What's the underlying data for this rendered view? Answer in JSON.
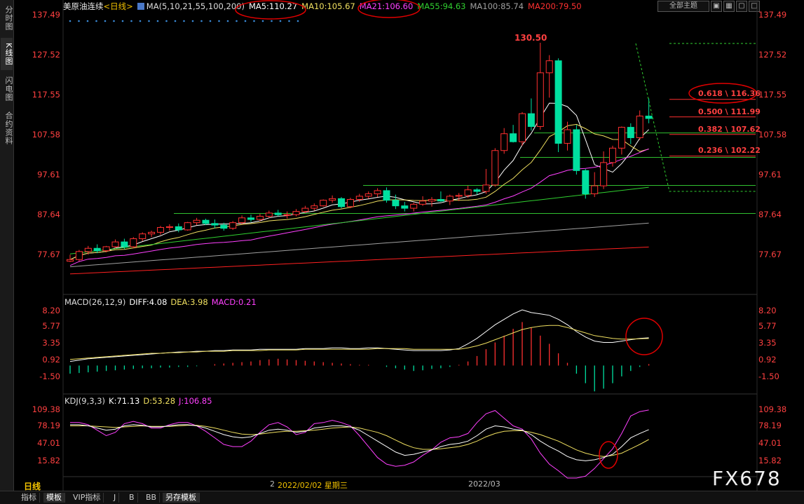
{
  "sidebar": {
    "tabs": [
      {
        "label": "分时图",
        "active": false
      },
      {
        "label": "K线图",
        "active": true
      },
      {
        "label": "闪电图",
        "active": false
      },
      {
        "label": "合约资料",
        "active": false
      }
    ]
  },
  "header": {
    "instrument": "美原油连续",
    "period": "<日线>",
    "ma_params": "MA(5,10,21,55,100,200)",
    "ma5": "MA5:110.27",
    "ma10": "MA10:105.67",
    "ma21": "MA21:106.60",
    "ma55": "MA55:94.63",
    "ma100": "MA100:85.74",
    "ma200": "MA200:79.50",
    "theme_select": "全部主题"
  },
  "colors": {
    "up": "#ff3030",
    "down": "#00e0a0",
    "ma5": "#ffffff",
    "ma10": "#f0e060",
    "ma21": "#ff40ff",
    "ma55": "#30d030",
    "ma100": "#a0a0a0",
    "ma200": "#ff2020",
    "axis": "#ff3c3c",
    "annotation": "#ff0000"
  },
  "price_axis": {
    "labels": [
      "137.49",
      "127.52",
      "117.55",
      "107.58",
      "97.61",
      "87.64",
      "77.67"
    ]
  },
  "fibonacci": [
    {
      "label": "0.618 \\ 116.36",
      "value": 116.36
    },
    {
      "label": "0.500 \\ 111.99",
      "value": 111.99
    },
    {
      "label": "0.382 \\ 107.62",
      "value": 107.62
    },
    {
      "label": "0.236 \\ 102.22",
      "value": 102.22
    }
  ],
  "high_label": "130.50",
  "macd": {
    "title": "MACD(26,12,9)",
    "diff": "DIFF:4.08",
    "dea": "DEA:3.98",
    "macd": "MACD:0.21",
    "axis_labels": [
      "8.20",
      "5.77",
      "3.35",
      "0.92",
      "-1.50"
    ]
  },
  "kdj": {
    "title": "KDJ(9,3,3)",
    "k": "K:71.13",
    "d": "D:53.28",
    "j": "J:106.85",
    "axis_labels": [
      "109.38",
      "78.19",
      "47.01",
      "15.82"
    ]
  },
  "x_axis": {
    "label_a": "2",
    "label_b": "2022/02/02 星期三",
    "label_c": "2022/03"
  },
  "period_label": "日线",
  "bottom_tabs": [
    {
      "label": "指标",
      "active": false
    },
    {
      "label": "模板",
      "active": true
    },
    {
      "label": "VIP指标",
      "active": false
    },
    {
      "label": "J",
      "active": false
    },
    {
      "label": "B",
      "active": false
    },
    {
      "label": "BB",
      "active": false
    },
    {
      "label": "另存模板",
      "active": true
    }
  ],
  "watermark": "FX678",
  "chart_data": {
    "type": "candlestick",
    "ylim": [
      72,
      140
    ],
    "candles": [
      [
        76.0,
        77.6,
        75.8,
        76.4
      ],
      [
        76.4,
        78.8,
        76.0,
        78.4
      ],
      [
        78.4,
        79.8,
        77.6,
        79.2
      ],
      [
        79.2,
        80.2,
        78.0,
        78.6
      ],
      [
        78.6,
        79.8,
        78.2,
        79.6
      ],
      [
        79.6,
        81.4,
        79.2,
        80.8
      ],
      [
        80.8,
        81.6,
        79.0,
        79.6
      ],
      [
        79.6,
        82.0,
        79.2,
        81.6
      ],
      [
        81.6,
        83.2,
        81.0,
        82.8
      ],
      [
        82.8,
        83.6,
        82.0,
        83.2
      ],
      [
        83.2,
        84.8,
        82.6,
        84.4
      ],
      [
        84.4,
        85.2,
        83.6,
        84.6
      ],
      [
        84.6,
        85.4,
        83.2,
        83.8
      ],
      [
        83.8,
        85.8,
        83.6,
        85.6
      ],
      [
        85.6,
        86.8,
        85.0,
        86.2
      ],
      [
        86.2,
        86.6,
        85.0,
        85.4
      ],
      [
        85.4,
        86.4,
        84.2,
        85.0
      ],
      [
        85.0,
        85.6,
        83.6,
        84.2
      ],
      [
        84.2,
        86.0,
        83.8,
        85.6
      ],
      [
        85.6,
        87.4,
        85.2,
        86.8
      ],
      [
        86.8,
        87.6,
        85.8,
        86.4
      ],
      [
        86.4,
        87.8,
        86.0,
        87.2
      ],
      [
        87.2,
        88.6,
        86.8,
        88.0
      ],
      [
        88.0,
        88.8,
        87.2,
        87.6
      ],
      [
        87.6,
        88.4,
        86.6,
        87.6
      ],
      [
        87.6,
        89.0,
        87.2,
        88.4
      ],
      [
        88.4,
        89.8,
        88.0,
        89.2
      ],
      [
        89.2,
        90.4,
        88.6,
        89.8
      ],
      [
        89.8,
        91.4,
        89.6,
        91.2
      ],
      [
        91.2,
        92.4,
        90.6,
        91.6
      ],
      [
        91.6,
        92.0,
        89.2,
        89.6
      ],
      [
        89.6,
        91.8,
        89.2,
        91.4
      ],
      [
        91.4,
        92.8,
        90.8,
        92.2
      ],
      [
        92.2,
        93.4,
        91.6,
        92.8
      ],
      [
        92.8,
        94.2,
        92.0,
        93.6
      ],
      [
        93.6,
        94.4,
        90.6,
        91.2
      ],
      [
        91.2,
        92.6,
        89.0,
        89.8
      ],
      [
        89.8,
        90.8,
        88.4,
        89.2
      ],
      [
        89.2,
        90.6,
        88.4,
        90.2
      ],
      [
        90.2,
        92.2,
        89.8,
        91.0
      ],
      [
        91.0,
        92.0,
        89.6,
        91.4
      ],
      [
        91.4,
        93.4,
        90.8,
        91.0
      ],
      [
        91.0,
        92.6,
        90.0,
        92.2
      ],
      [
        92.2,
        93.0,
        91.0,
        92.4
      ],
      [
        92.4,
        94.8,
        91.8,
        93.8
      ],
      [
        93.8,
        94.2,
        92.6,
        93.4
      ],
      [
        93.4,
        99.0,
        92.8,
        95.0
      ],
      [
        95.0,
        104.2,
        94.6,
        103.6
      ],
      [
        103.6,
        109.2,
        102.8,
        107.8
      ],
      [
        107.8,
        110.0,
        105.6,
        105.8
      ],
      [
        105.8,
        113.2,
        104.8,
        112.8
      ],
      [
        112.8,
        116.6,
        108.6,
        109.6
      ],
      [
        109.6,
        130.5,
        108.8,
        123.0
      ],
      [
        123.0,
        127.4,
        116.8,
        126.0
      ],
      [
        126.0,
        126.6,
        103.2,
        105.4
      ],
      [
        105.4,
        110.8,
        103.6,
        108.8
      ],
      [
        108.8,
        110.0,
        97.6,
        98.6
      ],
      [
        98.6,
        99.0,
        91.6,
        92.8
      ],
      [
        92.8,
        98.2,
        92.0,
        94.8
      ],
      [
        94.8,
        103.4,
        94.0,
        100.6
      ],
      [
        100.6,
        104.8,
        99.6,
        104.2
      ],
      [
        104.2,
        109.6,
        102.6,
        109.4
      ],
      [
        109.4,
        110.4,
        105.2,
        106.8
      ],
      [
        106.8,
        113.6,
        106.2,
        112.2
      ],
      [
        112.2,
        116.6,
        110.4,
        111.6
      ]
    ],
    "macd_values": [
      -1.2,
      -1.1,
      -1.0,
      -0.9,
      -0.8,
      -0.7,
      -0.6,
      -0.5,
      -0.4,
      -0.4,
      -0.3,
      -0.3,
      -0.2,
      -0.2,
      -0.1,
      0,
      0.2,
      0.3,
      0.4,
      0.5,
      0.6,
      0.8,
      0.9,
      1.0,
      0.9,
      0.8,
      0.7,
      0.6,
      0.5,
      0.4,
      0.3,
      0.2,
      0.1,
      0.1,
      0,
      -0.2,
      -0.4,
      -0.6,
      -0.8,
      -0.7,
      -0.5,
      -0.4,
      -0.2,
      0.1,
      0.6,
      1.4,
      2.4,
      3.4,
      4.4,
      5.4,
      6.4,
      5.6,
      4.4,
      3.2,
      1.8,
      0.4,
      -1.2,
      -2.6,
      -3.8,
      -3.4,
      -2.6,
      -1.6,
      -0.8,
      -0.2,
      0.21
    ],
    "diff": [
      0.6,
      0.8,
      1.0,
      1.1,
      1.2,
      1.3,
      1.4,
      1.5,
      1.6,
      1.7,
      1.8,
      1.9,
      2.0,
      2.0,
      2.1,
      2.1,
      2.2,
      2.2,
      2.3,
      2.3,
      2.3,
      2.4,
      2.4,
      2.4,
      2.4,
      2.4,
      2.5,
      2.5,
      2.5,
      2.6,
      2.6,
      2.5,
      2.5,
      2.6,
      2.6,
      2.5,
      2.4,
      2.3,
      2.2,
      2.2,
      2.2,
      2.2,
      2.3,
      2.5,
      3.2,
      4.0,
      5.0,
      6.0,
      6.8,
      7.6,
      8.2,
      7.8,
      7.6,
      7.4,
      6.8,
      6.0,
      5.0,
      4.2,
      3.6,
      3.4,
      3.4,
      3.6,
      3.8,
      4.0,
      4.08
    ],
    "dea": [
      0.9,
      1.0,
      1.1,
      1.2,
      1.3,
      1.4,
      1.5,
      1.6,
      1.7,
      1.8,
      1.8,
      1.9,
      1.9,
      2.0,
      2.0,
      2.1,
      2.1,
      2.1,
      2.2,
      2.2,
      2.2,
      2.2,
      2.3,
      2.3,
      2.3,
      2.3,
      2.4,
      2.4,
      2.4,
      2.4,
      2.4,
      2.4,
      2.4,
      2.4,
      2.5,
      2.5,
      2.5,
      2.5,
      2.4,
      2.4,
      2.4,
      2.4,
      2.4,
      2.4,
      2.6,
      2.9,
      3.3,
      3.8,
      4.3,
      4.8,
      5.3,
      5.6,
      5.8,
      5.9,
      5.9,
      5.6,
      5.2,
      4.8,
      4.4,
      4.2,
      4.0,
      3.9,
      3.9,
      3.95,
      3.98
    ],
    "k": [
      80,
      80,
      78,
      74,
      70,
      72,
      78,
      80,
      79,
      76,
      76,
      78,
      80,
      80,
      78,
      74,
      68,
      62,
      58,
      56,
      58,
      64,
      70,
      72,
      70,
      66,
      68,
      74,
      76,
      78,
      78,
      76,
      70,
      60,
      50,
      40,
      30,
      24,
      26,
      30,
      34,
      40,
      44,
      46,
      50,
      60,
      72,
      78,
      76,
      72,
      70,
      62,
      50,
      40,
      32,
      22,
      16,
      14,
      16,
      20,
      26,
      40,
      56,
      64,
      71
    ],
    "d": [
      78,
      78,
      78,
      77,
      76,
      75,
      76,
      77,
      78,
      77,
      77,
      77,
      78,
      79,
      79,
      77,
      74,
      70,
      66,
      63,
      62,
      63,
      65,
      67,
      68,
      68,
      69,
      70,
      72,
      74,
      75,
      76,
      74,
      70,
      66,
      60,
      52,
      44,
      38,
      35,
      35,
      36,
      38,
      40,
      44,
      50,
      58,
      64,
      68,
      69,
      69,
      66,
      62,
      56,
      50,
      42,
      34,
      28,
      24,
      22,
      24,
      28,
      36,
      44,
      53
    ],
    "j": [
      84,
      84,
      80,
      70,
      60,
      66,
      82,
      86,
      82,
      74,
      74,
      80,
      84,
      84,
      78,
      68,
      56,
      44,
      40,
      40,
      50,
      66,
      80,
      84,
      76,
      62,
      66,
      82,
      84,
      88,
      84,
      78,
      60,
      40,
      20,
      8,
      4,
      6,
      12,
      24,
      34,
      48,
      56,
      58,
      64,
      84,
      100,
      106,
      92,
      78,
      72,
      54,
      28,
      8,
      -4,
      -18,
      -22,
      -14,
      0,
      18,
      36,
      64,
      96,
      104,
      107
    ]
  }
}
